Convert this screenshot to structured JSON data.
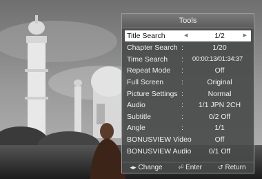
{
  "panel": {
    "title": "Tools",
    "rows": [
      {
        "label": "Title Search",
        "sep": "",
        "value": "1/2",
        "selected": true
      },
      {
        "label": "Chapter Search",
        "sep": ":",
        "value": "1/20"
      },
      {
        "label": "Time Search",
        "sep": ":",
        "value": "00:00:13/01:34:37"
      },
      {
        "label": "Repeat Mode",
        "sep": ":",
        "value": "Off"
      },
      {
        "label": "Full Screen",
        "sep": ":",
        "value": "Original"
      },
      {
        "label": "Picture Settings",
        "sep": ":",
        "value": "Normal"
      },
      {
        "label": "Audio",
        "sep": ":",
        "value": "1/1 JPN 2CH"
      },
      {
        "label": "Subtitle",
        "sep": ":",
        "value": "0/2 Off"
      },
      {
        "label": "Angle",
        "sep": ":",
        "value": "1/1"
      },
      {
        "label": "BONUSVIEW Video",
        "sep": ":",
        "value": "Off"
      },
      {
        "label": "BONUSVIEW Audio",
        "sep": ":",
        "value": "0/1 Off"
      }
    ],
    "footer": {
      "change": "Change",
      "enter": "Enter",
      "return": "Return"
    }
  }
}
